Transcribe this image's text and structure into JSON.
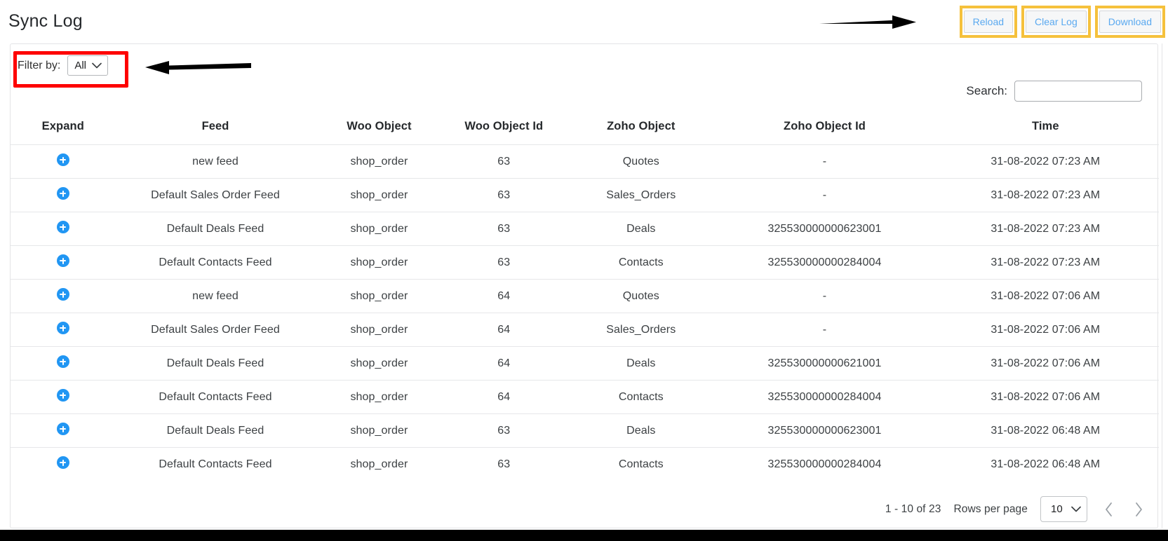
{
  "header": {
    "title": "Sync Log",
    "actions": [
      {
        "label": "Reload",
        "name": "reload-button"
      },
      {
        "label": "Clear Log",
        "name": "clear-log-button"
      },
      {
        "label": "Download",
        "name": "download-button"
      }
    ]
  },
  "filter": {
    "label": "Filter by:",
    "selected": "All",
    "options": [
      "All"
    ]
  },
  "search": {
    "label": "Search:",
    "value": "",
    "placeholder": ""
  },
  "table": {
    "columns": [
      "Expand",
      "Feed",
      "Woo Object",
      "Woo Object Id",
      "Zoho Object",
      "Zoho Object Id",
      "Time"
    ],
    "rows": [
      {
        "expand": "plus-circle-icon",
        "feed": "new feed",
        "woo_object": "shop_order",
        "woo_object_id": "63",
        "zoho_object": "Quotes",
        "zoho_object_id": "-",
        "time": "31-08-2022 07:23 AM"
      },
      {
        "expand": "plus-circle-icon",
        "feed": "Default Sales Order Feed",
        "woo_object": "shop_order",
        "woo_object_id": "63",
        "zoho_object": "Sales_Orders",
        "zoho_object_id": "-",
        "time": "31-08-2022 07:23 AM"
      },
      {
        "expand": "plus-circle-icon",
        "feed": "Default Deals Feed",
        "woo_object": "shop_order",
        "woo_object_id": "63",
        "zoho_object": "Deals",
        "zoho_object_id": "325530000000623001",
        "time": "31-08-2022 07:23 AM"
      },
      {
        "expand": "plus-circle-icon",
        "feed": "Default Contacts Feed",
        "woo_object": "shop_order",
        "woo_object_id": "63",
        "zoho_object": "Contacts",
        "zoho_object_id": "325530000000284004",
        "time": "31-08-2022 07:23 AM"
      },
      {
        "expand": "plus-circle-icon",
        "feed": "new feed",
        "woo_object": "shop_order",
        "woo_object_id": "64",
        "zoho_object": "Quotes",
        "zoho_object_id": "-",
        "time": "31-08-2022 07:06 AM"
      },
      {
        "expand": "plus-circle-icon",
        "feed": "Default Sales Order Feed",
        "woo_object": "shop_order",
        "woo_object_id": "64",
        "zoho_object": "Sales_Orders",
        "zoho_object_id": "-",
        "time": "31-08-2022 07:06 AM"
      },
      {
        "expand": "plus-circle-icon",
        "feed": "Default Deals Feed",
        "woo_object": "shop_order",
        "woo_object_id": "64",
        "zoho_object": "Deals",
        "zoho_object_id": "325530000000621001",
        "time": "31-08-2022 07:06 AM"
      },
      {
        "expand": "plus-circle-icon",
        "feed": "Default Contacts Feed",
        "woo_object": "shop_order",
        "woo_object_id": "64",
        "zoho_object": "Contacts",
        "zoho_object_id": "325530000000284004",
        "time": "31-08-2022 07:06 AM"
      },
      {
        "expand": "plus-circle-icon",
        "feed": "Default Deals Feed",
        "woo_object": "shop_order",
        "woo_object_id": "63",
        "zoho_object": "Deals",
        "zoho_object_id": "325530000000623001",
        "time": "31-08-2022 06:48 AM"
      },
      {
        "expand": "plus-circle-icon",
        "feed": "Default Contacts Feed",
        "woo_object": "shop_order",
        "woo_object_id": "63",
        "zoho_object": "Contacts",
        "zoho_object_id": "325530000000284004",
        "time": "31-08-2022 06:48 AM"
      }
    ]
  },
  "pagination": {
    "range": "1 - 10 of 23",
    "rows_per_page_label": "Rows per page",
    "rows_per_page": "10",
    "rows_per_page_options": [
      "10"
    ],
    "prev_icon": "chevron-left-icon",
    "next_icon": "chevron-right-icon"
  },
  "annotations": {
    "filter_highlight_color": "#fe0000",
    "button_highlight_color": "#f5c13c",
    "arrow_color": "#000000"
  }
}
